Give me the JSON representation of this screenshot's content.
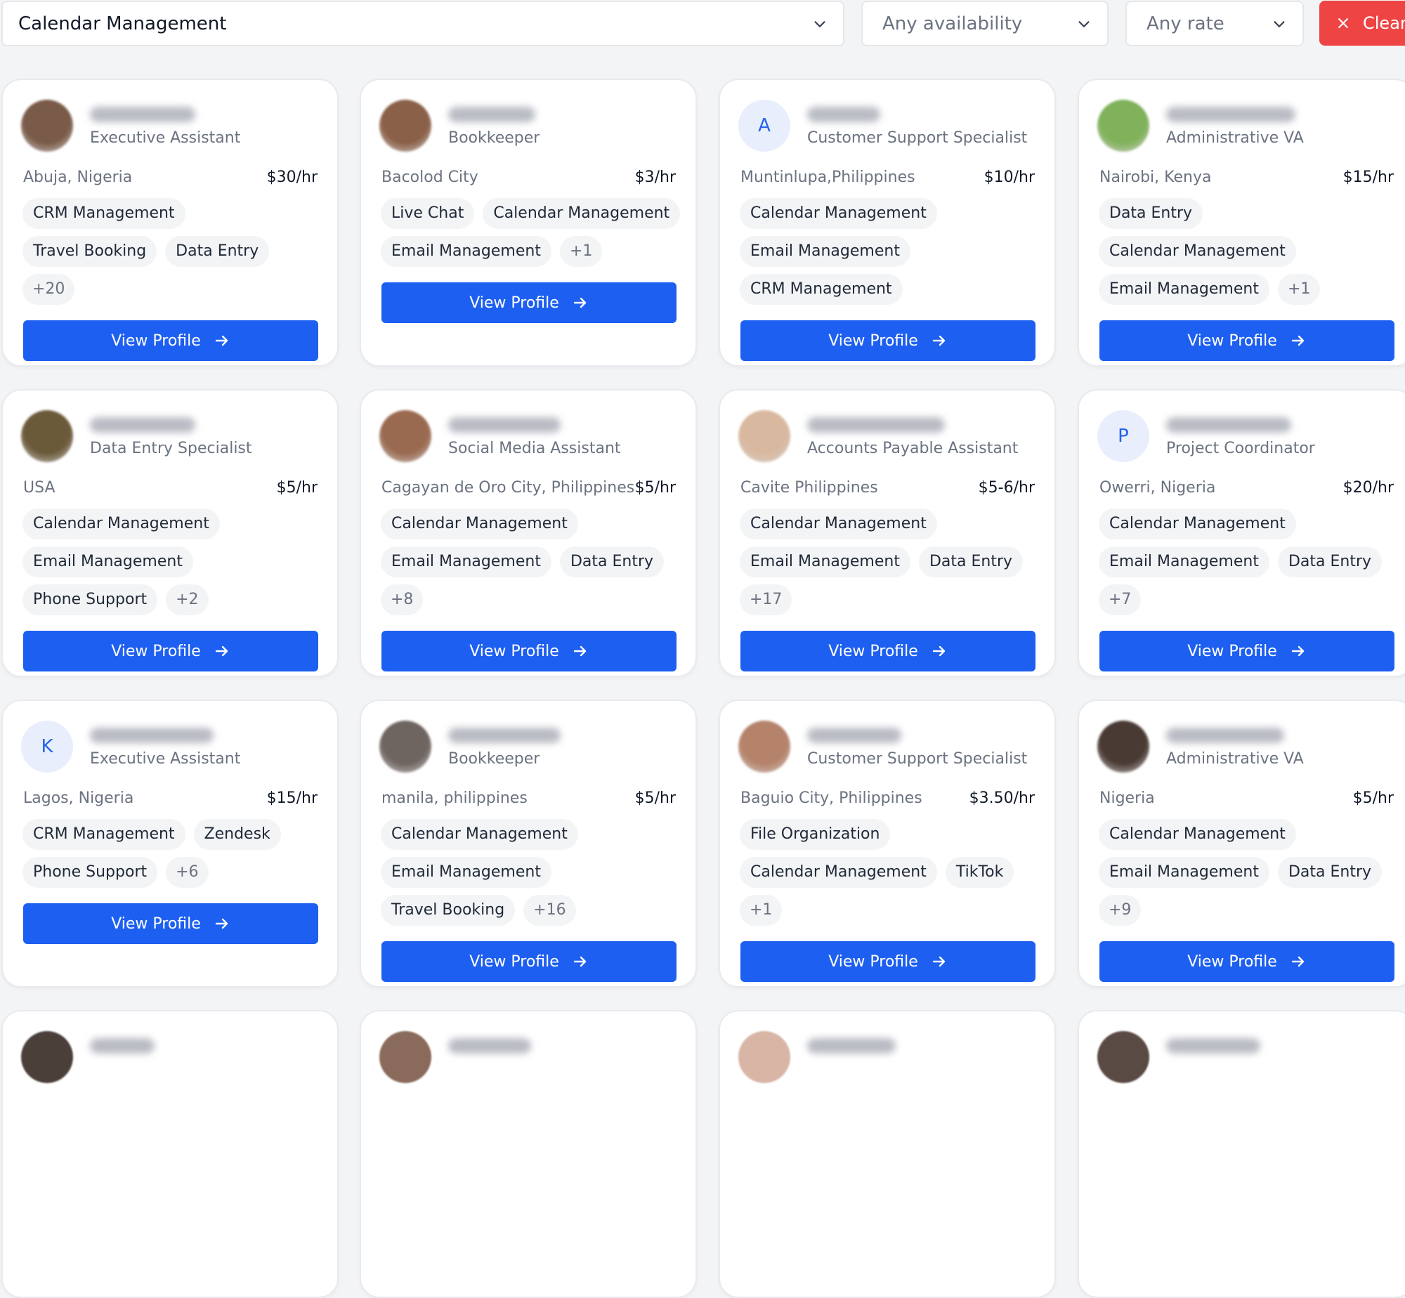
{
  "filters": {
    "skill": "Calendar Management",
    "availability": "Any availability",
    "rate": "Any rate",
    "clear_label": "Clear"
  },
  "view_label": "View Profile",
  "cards": [
    {
      "title": "Executive Assistant",
      "location": "Abuja, Nigeria",
      "rate": "$30/hr",
      "tags": [
        "CRM Management",
        "Travel Booking",
        "Data Entry"
      ],
      "more": "+20",
      "avatar": "#7a5a48"
    },
    {
      "title": "Bookkeeper",
      "location": "Bacolod City",
      "rate": "$3/hr",
      "tags": [
        "Live Chat",
        "Calendar Management",
        "Email Management"
      ],
      "more": "+1",
      "avatar": "#8a6048"
    },
    {
      "title": "Customer Support Specialist",
      "location": "Muntinlupa,Philippines",
      "rate": "$10/hr",
      "tags": [
        "Calendar Management",
        "Email Management",
        "CRM Management"
      ],
      "more": "",
      "avatar_letter": "A"
    },
    {
      "title": "Administrative VA",
      "location": "Nairobi, Kenya",
      "rate": "$15/hr",
      "tags": [
        "Data Entry",
        "Calendar Management",
        "Email Management"
      ],
      "more": "+1",
      "avatar": "#7fb25a"
    },
    {
      "title": "Data Entry Specialist",
      "location": "USA",
      "rate": "$5/hr",
      "tags": [
        "Calendar Management",
        "Email Management",
        "Phone Support"
      ],
      "more": "+2",
      "avatar": "#6b5a3a"
    },
    {
      "title": "Social Media Assistant",
      "location": "Cagayan de Oro City, Philippines",
      "rate": "$5/hr",
      "tags": [
        "Calendar Management",
        "Email Management",
        "Data Entry"
      ],
      "more": "+8",
      "avatar": "#9a6a50"
    },
    {
      "title": "Accounts Payable Assistant",
      "location": "Cavite Philippines",
      "rate": "$5-6/hr",
      "tags": [
        "Calendar Management",
        "Email Management",
        "Data Entry"
      ],
      "more": "+17",
      "avatar": "#d9b8a0"
    },
    {
      "title": "Project Coordinator",
      "location": "Owerri, Nigeria",
      "rate": "$20/hr",
      "tags": [
        "Calendar Management",
        "Email Management",
        "Data Entry"
      ],
      "more": "+7",
      "avatar_letter": "P"
    },
    {
      "title": "Executive Assistant",
      "location": "Lagos, Nigeria",
      "rate": "$15/hr",
      "tags": [
        "CRM Management",
        "Zendesk",
        "Phone Support"
      ],
      "more": "+6",
      "avatar_letter": "K"
    },
    {
      "title": "Bookkeeper",
      "location": "manila, philippines",
      "rate": "$5/hr",
      "tags": [
        "Calendar Management",
        "Email Management",
        "Travel Booking"
      ],
      "more": "+16",
      "avatar": "#6e6460"
    },
    {
      "title": "Customer Support Specialist",
      "location": "Baguio City, Philippines",
      "rate": "$3.50/hr",
      "tags": [
        "File Organization",
        "Calendar Management",
        "TikTok"
      ],
      "more": "+1",
      "avatar": "#b5826a"
    },
    {
      "title": "Administrative VA",
      "location": "Nigeria",
      "rate": "$5/hr",
      "tags": [
        "Calendar Management",
        "Email Management",
        "Data Entry"
      ],
      "more": "+9",
      "avatar": "#4a3a34"
    }
  ]
}
